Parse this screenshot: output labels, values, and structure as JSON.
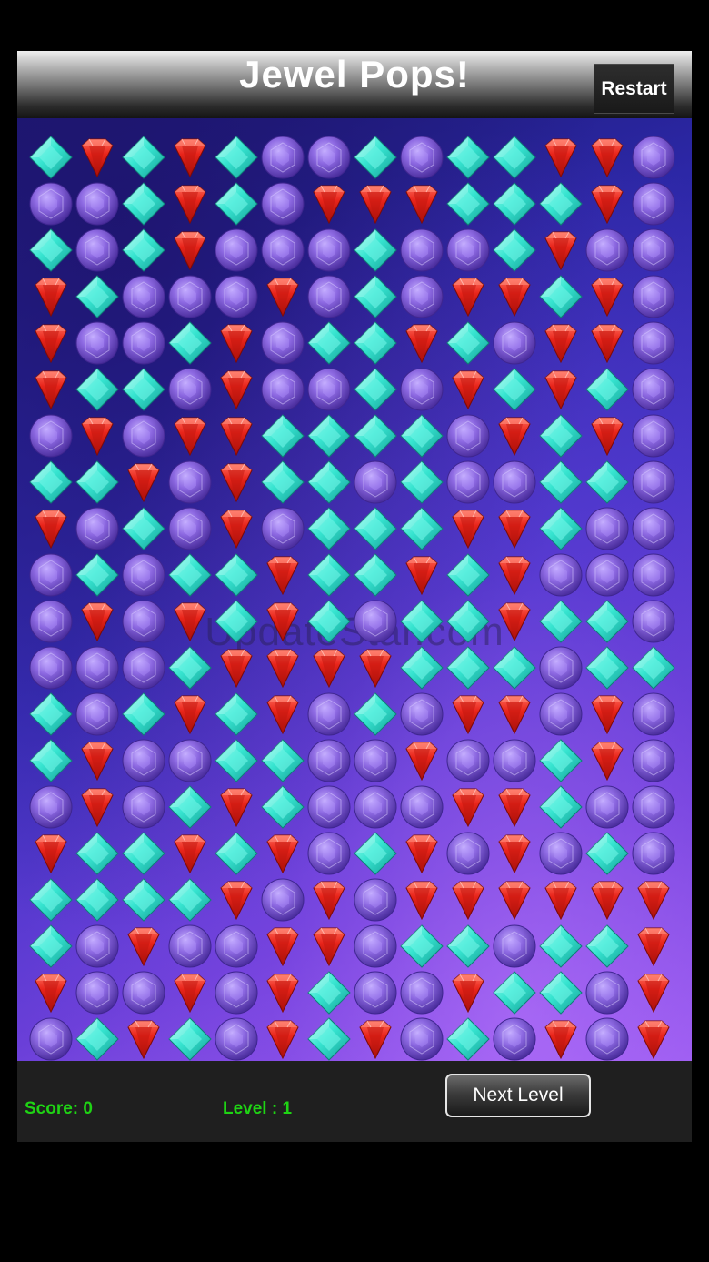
{
  "header": {
    "title": "Jewel Pops!",
    "restart_label": "Restart"
  },
  "board": {
    "watermark": "UpdateStar.com",
    "gem_types": {
      "C": "cyan-diamond-gem",
      "R": "red-ruby-gem",
      "P": "purple-round-gem"
    },
    "rows": [
      "CRCRCPPCPCCRRP",
      "PPCRCPRRRCCCRP",
      "CPCRPPPCPPCRPP",
      "RCPPPRPCPRRCRP",
      "RPPCRPCCRCPRRP",
      "RCCPRPPCPRCRCP",
      "PRPRRCCCCPRCRP",
      "CCRPRCCPCPPCCP",
      "RPCPRPCCCRRCPP",
      "PCPCCRCCRCRPPP",
      "PRPRCRCPCCRCCP",
      "PPPCRRRRCCCPCC",
      "CPCRCRPCPRRPRP",
      "CRPPCCPPRPPCRP",
      "PRPCRCPPPRRCPP",
      "RCCRCRPCRPRPCP",
      "CCCCRPRPRRRRRR",
      "CPRPPRRPCCPCCR",
      "RPPRPRCPPRCCPR",
      "PCRCPRCRPCPRPR"
    ]
  },
  "footer": {
    "score_label": "Score: 0",
    "level_label": "Level : 1",
    "next_level_label": "Next Level"
  },
  "colors": {
    "accent_green": "#1fd314",
    "gem_cyan": "#35e6d2",
    "gem_red": "#e2231a",
    "gem_purple": "#8a64e0"
  }
}
